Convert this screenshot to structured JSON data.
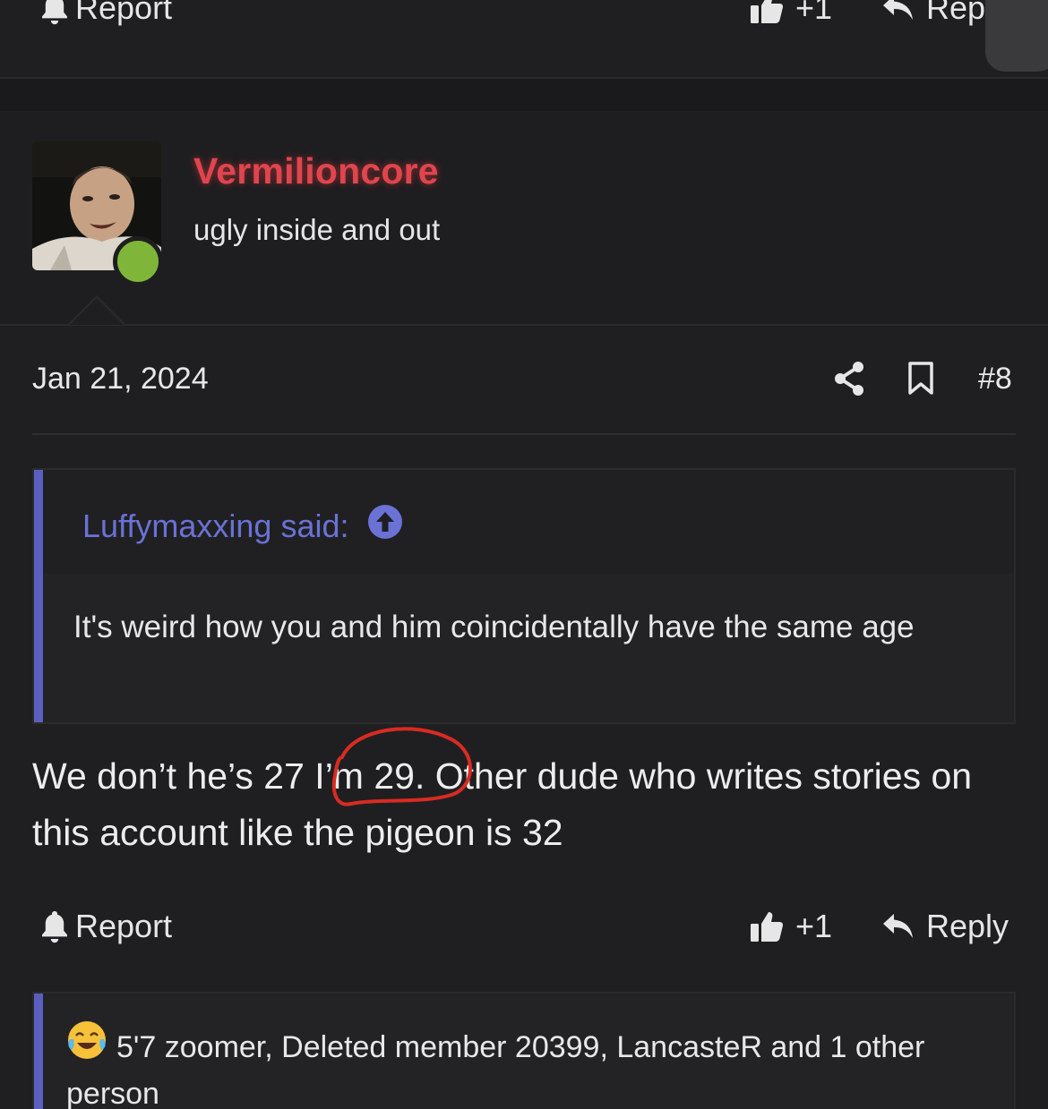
{
  "top_actions": {
    "report_label": "Report",
    "like_count": "+1",
    "reply_label": "Rep"
  },
  "user": {
    "username": "Vermilioncore",
    "title": "ugly inside and out",
    "online": true
  },
  "post": {
    "date": "Jan 21, 2024",
    "number": "#8",
    "quote": {
      "author_label": "Luffymaxxing said:",
      "text": "It's weird how you and him coincidentally have the same age"
    },
    "message": "We don’t he’s 27 I’m 29. Other dude who writes stories on this account like the pigeon is 32",
    "annotation": "I’m 29."
  },
  "bottom_actions": {
    "report_label": "Report",
    "like_count": "+1",
    "reply_label": "Reply"
  },
  "reactions": {
    "text": "5'7 zoomer, Deleted member 20399, LancasteR and 1 other person",
    "emoji": "laughing-crying-emoji"
  },
  "colors": {
    "background": "#1f1f21",
    "username": "#e0454d",
    "quote_accent": "#5a5fbf",
    "quote_author": "#6a72d6",
    "online": "#7fb639",
    "annotation_circle": "#d92b22"
  }
}
